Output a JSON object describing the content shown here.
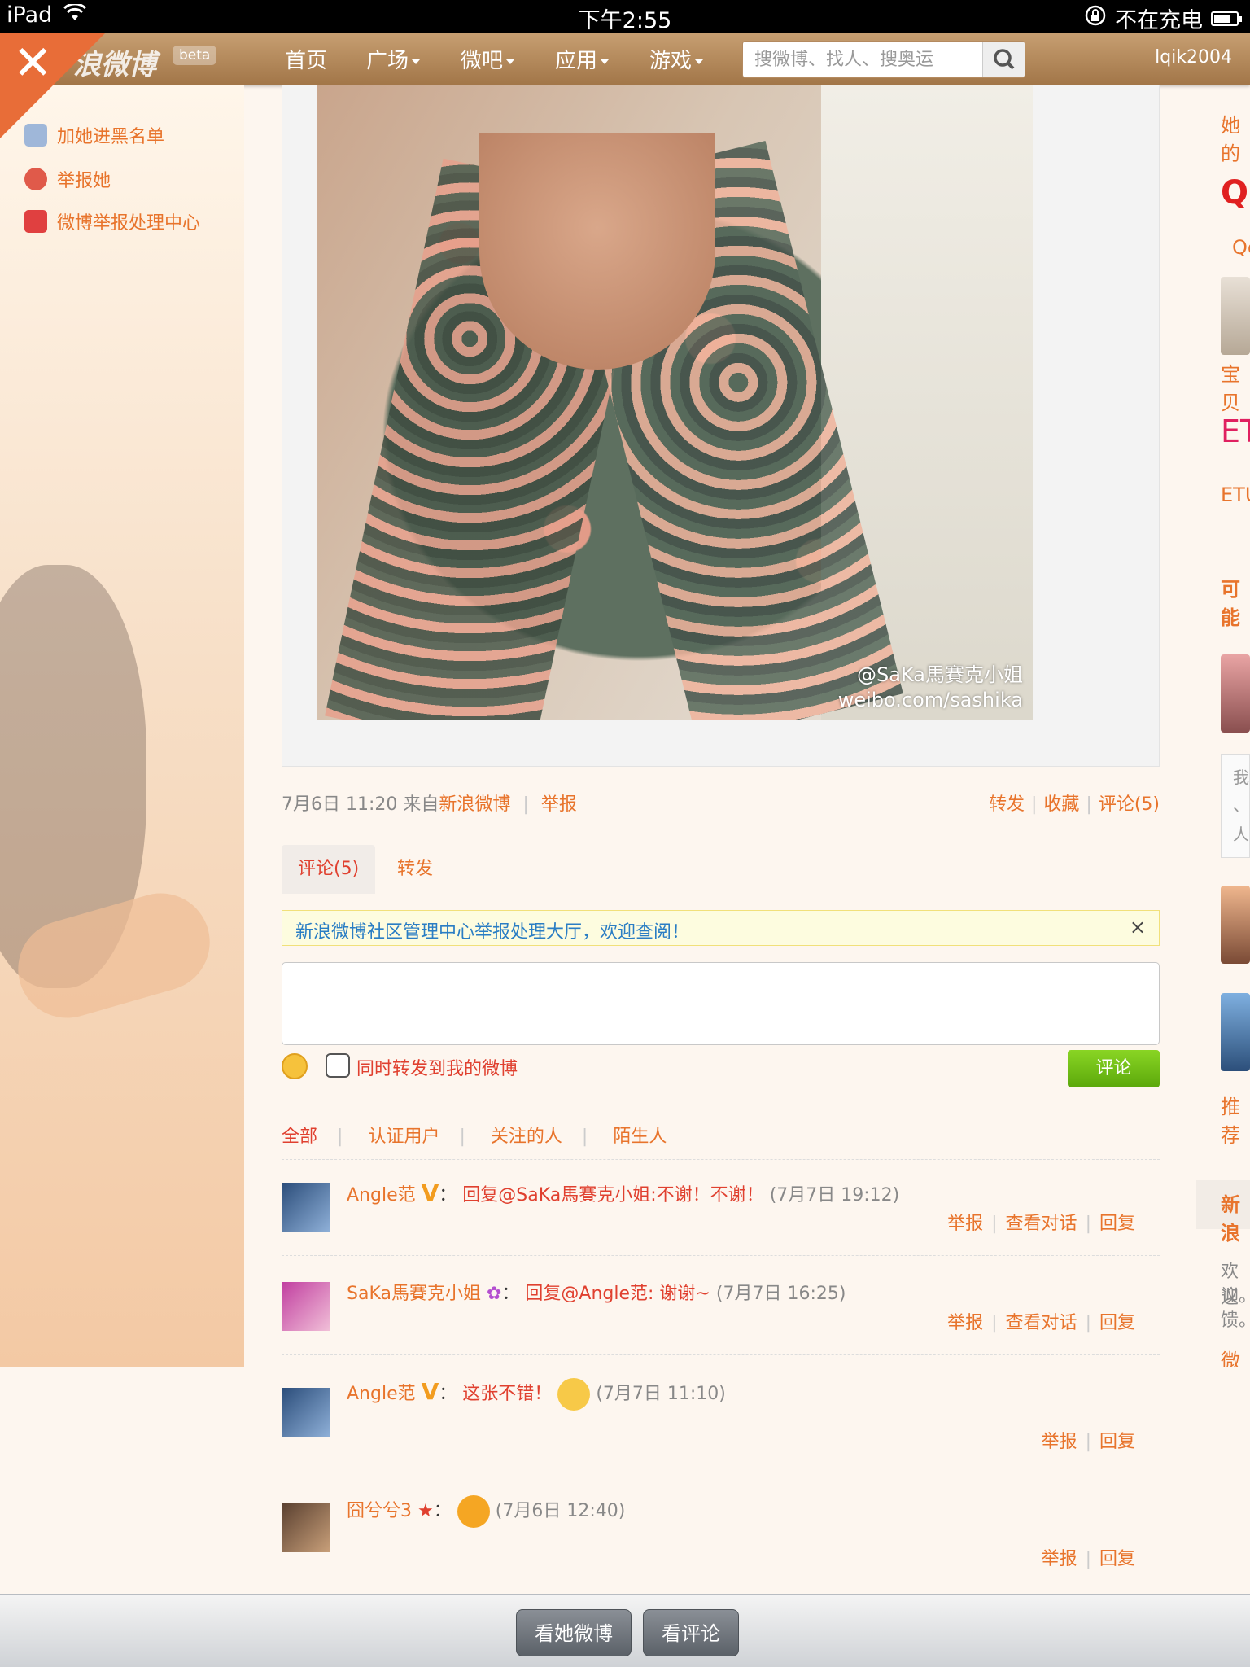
{
  "status_bar": {
    "device": "iPad",
    "time": "下午2:55",
    "charging_text": "不在充电"
  },
  "nav": {
    "logo": "浪微博",
    "beta": "beta",
    "links": [
      "首页",
      "广场",
      "微吧",
      "应用",
      "游戏"
    ],
    "search_placeholder": "搜微博、找人、搜奥运",
    "username": "lqik2004",
    "close_icon": "close-icon"
  },
  "left_sidebar": {
    "items": [
      "加她进黑名单",
      "举报她",
      "微博举报处理中心"
    ]
  },
  "post": {
    "watermark_user": "@SaKa馬賽克小姐",
    "watermark_url": "weibo.com/sashika",
    "date": "7月6日 11:20",
    "source_prefix": "来自",
    "source": "新浪微博",
    "report": "举报",
    "repost": "转发",
    "favorite": "收藏",
    "comment_count": "评论(5)"
  },
  "tabs": {
    "active": "评论(5)",
    "other": "转发"
  },
  "notice": {
    "text": "新浪微博社区管理中心举报处理大厅，欢迎查阅！",
    "close": "×"
  },
  "comment_form": {
    "repost_label": "同时转发到我的微博",
    "submit": "评论"
  },
  "filters": [
    "全部",
    "认证用户",
    "关注的人",
    "陌生人"
  ],
  "comments": [
    {
      "author": "Angle范",
      "badge": "V",
      "separator": "：",
      "text": "回复@SaKa馬賽克小姐:不谢！不谢！",
      "time": "(7月7日 19:12)",
      "actions": [
        "举报",
        "查看对话",
        "回复"
      ]
    },
    {
      "author": "SaKa馬賽克小姐",
      "badge": "",
      "separator": "：",
      "text": "回复@Angle范: 谢谢~",
      "time": "(7月7日 16:25)",
      "actions": [
        "举报",
        "查看对话",
        "回复"
      ]
    },
    {
      "author": "Angle范",
      "badge": "V",
      "separator": "：",
      "text": "这张不错！",
      "time": "(7月7日 11:10)",
      "actions": [
        "举报",
        "回复"
      ]
    },
    {
      "author": "囧兮兮3",
      "badge": "",
      "separator": "：",
      "text": "",
      "time": "(7月6日 12:40)",
      "actions": [
        "举报",
        "回复"
      ]
    }
  ],
  "right_sidebar": {
    "fragments": [
      "她的",
      "Q",
      "Qc",
      "宝贝",
      "ET",
      "ETU",
      "可能",
      "我",
      "、",
      "人",
      "推荐",
      "新浪",
      "欢迎",
      "议。",
      "馈。",
      "微",
      "微"
    ]
  },
  "bottom_bar": {
    "btn_weibo": "看她微博",
    "btn_comments": "看评论"
  },
  "colors": {
    "accent": "#e8742c",
    "red_text": "#e0402f",
    "link_blue": "#2a7dc4",
    "submit_green": "#6cbb12"
  }
}
